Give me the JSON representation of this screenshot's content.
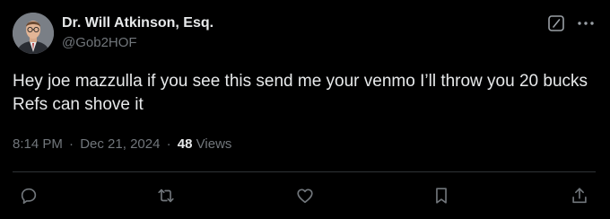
{
  "author": {
    "name": "Dr. Will Atkinson, Esq.",
    "handle": "@Gob2HOF",
    "avatar": "avatar-photo"
  },
  "tweet": {
    "text": "Hey joe mazzulla if you see this send me your venmo I’ll throw you 20 bucks Refs can shove it"
  },
  "meta": {
    "time": "8:14 PM",
    "separator": "·",
    "date": "Dec 21, 2024",
    "views_count": "48",
    "views_label": "Views"
  },
  "icons": {
    "grok": "grok-icon",
    "more": "more-icon",
    "reply": "reply-icon",
    "retweet": "retweet-icon",
    "like": "like-icon",
    "bookmark": "bookmark-icon",
    "share": "share-icon"
  },
  "colors": {
    "background": "#000000",
    "text": "#e7e9ea",
    "secondary": "#71767b",
    "divider": "#2f3336"
  }
}
